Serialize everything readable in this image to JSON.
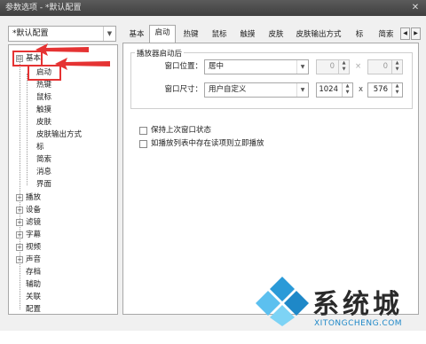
{
  "window": {
    "title": "参数选项 - *默认配置",
    "close_glyph": "✕"
  },
  "profile_select": {
    "value": "*默认配置"
  },
  "tree": {
    "items": [
      {
        "label": "基本",
        "toggle": "⊟"
      },
      {
        "label": "启动"
      },
      {
        "label": "热键"
      },
      {
        "label": "鼠标"
      },
      {
        "label": "触摸"
      },
      {
        "label": "皮肤"
      },
      {
        "label": "皮肤输出方式"
      },
      {
        "label": "标"
      },
      {
        "label": "简索"
      },
      {
        "label": "消息"
      },
      {
        "label": "界面"
      },
      {
        "label": "播放",
        "toggle": "+"
      },
      {
        "label": "设备",
        "toggle": "+"
      },
      {
        "label": "滤镜",
        "toggle": "+"
      },
      {
        "label": "字幕",
        "toggle": "+"
      },
      {
        "label": "视频",
        "toggle": "+"
      },
      {
        "label": "声音",
        "toggle": "+"
      },
      {
        "label": "存档"
      },
      {
        "label": "辅助"
      },
      {
        "label": "关联"
      },
      {
        "label": "配置"
      }
    ]
  },
  "tabs": [
    "基本",
    "启动",
    "热键",
    "鼠标",
    "触摸",
    "皮肤",
    "皮肤输出方式",
    "标",
    "简索"
  ],
  "active_tab": "启动",
  "tab_nav": {
    "prev": "◀",
    "next": "▶"
  },
  "panel": {
    "group_title": "播放器启动后",
    "window_position": {
      "label": "窗口位置：",
      "value": "居中",
      "x": "0",
      "sep": "×",
      "y": "0"
    },
    "window_size": {
      "label": "窗口尺寸：",
      "value": "用户自定义",
      "width": "1024",
      "sep": "x",
      "height": "576"
    },
    "checkbox_keep_state": "保持上次窗口状态",
    "checkbox_playlist": "如播放列表中存在读项则立即播放"
  },
  "watermark": {
    "brand": "系统城",
    "site": "XITONGCHENG.COM"
  },
  "colors": {
    "highlight": "#e53333",
    "titlebar": "#4a4a4a",
    "watermark_blue": "#1e88c8"
  }
}
